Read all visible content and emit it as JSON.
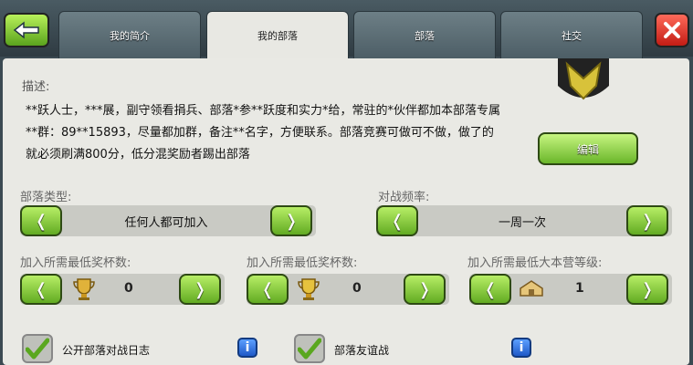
{
  "tabs": [
    "我的简介",
    "我的部落",
    "部落",
    "社交"
  ],
  "description": {
    "label": "描述:",
    "text": "**跃人士，***展，副守领看捐兵、部落*参**跃度和实力*给，常驻的*伙伴都加本部落专属**群：89**15893，尽量都加群，备注**名字，方便联系。部落竞赛可做可不做，做了的就必须刷满800分，低分混奖励者踢出部落"
  },
  "edit_label": "编辑",
  "clan_type": {
    "label": "部落类型:",
    "value": "任何人都可加入"
  },
  "war_frequency": {
    "label": "对战频率:",
    "value": "一周一次"
  },
  "min_trophies": {
    "label": "加入所需最低奖杯数:",
    "value": "0"
  },
  "min_builder_trophies": {
    "label": "加入所需最低奖杯数:",
    "value": "0"
  },
  "min_townhall": {
    "label": "加入所需最低大本营等级:",
    "value": "1"
  },
  "public_war_log": {
    "label": "公开部落对战日志",
    "checked": true
  },
  "friendly_wars": {
    "label": "部落友谊战",
    "checked": true
  },
  "arrows": {
    "left": "❬",
    "right": "❭"
  },
  "colors": {
    "green": "#6ab62a",
    "red": "#c21c14",
    "blue": "#1f59c7"
  }
}
